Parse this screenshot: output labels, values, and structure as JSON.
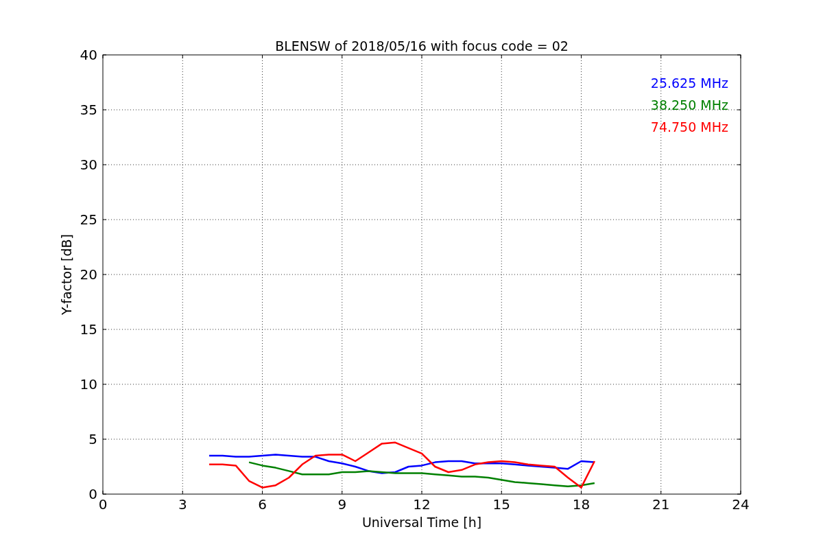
{
  "chart_data": {
    "type": "line",
    "title": "BLENSW of 2018/05/16 with focus code = 02",
    "xlabel": "Universal Time [h]",
    "ylabel": "Y-factor [dB]",
    "x": [
      4,
      4.5,
      5,
      5.5,
      6,
      6.5,
      7,
      7.5,
      8,
      8.5,
      9,
      9.5,
      10,
      10.5,
      11,
      11.5,
      12,
      12.5,
      13,
      13.5,
      14,
      14.5,
      15,
      15.5,
      16,
      16.5,
      17,
      17.5,
      18,
      18.5
    ],
    "series": [
      {
        "name": "25.625 MHz",
        "color": "#0000ff",
        "values": [
          3.5,
          3.5,
          3.4,
          3.4,
          3.5,
          3.6,
          3.5,
          3.4,
          3.4,
          3.0,
          2.8,
          2.5,
          2.1,
          1.9,
          2.0,
          2.5,
          2.6,
          2.9,
          3.0,
          3.0,
          2.8,
          2.8,
          2.8,
          2.7,
          2.6,
          2.5,
          2.4,
          2.3,
          3.0,
          2.9
        ]
      },
      {
        "name": "38.250 MHz",
        "color": "#008000",
        "values": [
          null,
          null,
          null,
          2.9,
          2.6,
          2.4,
          2.1,
          1.8,
          1.8,
          1.8,
          2.0,
          2.0,
          2.1,
          2.0,
          1.9,
          1.9,
          1.9,
          1.8,
          1.7,
          1.6,
          1.6,
          1.5,
          1.3,
          1.1,
          1.0,
          0.9,
          0.8,
          0.7,
          0.8,
          1.0
        ]
      },
      {
        "name": "74.750 MHz",
        "color": "#ff0000",
        "values": [
          2.7,
          2.7,
          2.6,
          1.2,
          0.6,
          0.8,
          1.5,
          2.7,
          3.5,
          3.6,
          3.6,
          3.0,
          3.8,
          4.6,
          4.7,
          4.2,
          3.7,
          2.5,
          2.0,
          2.2,
          2.7,
          2.9,
          3.0,
          2.9,
          2.7,
          2.6,
          2.5,
          1.5,
          0.6,
          3.0
        ]
      }
    ],
    "xlim": [
      0,
      24
    ],
    "ylim": [
      0,
      40
    ],
    "xticks": [
      0,
      3,
      6,
      9,
      12,
      15,
      18,
      21,
      24
    ],
    "yticks": [
      0,
      5,
      10,
      15,
      20,
      25,
      30,
      35,
      40
    ],
    "grid": true
  }
}
